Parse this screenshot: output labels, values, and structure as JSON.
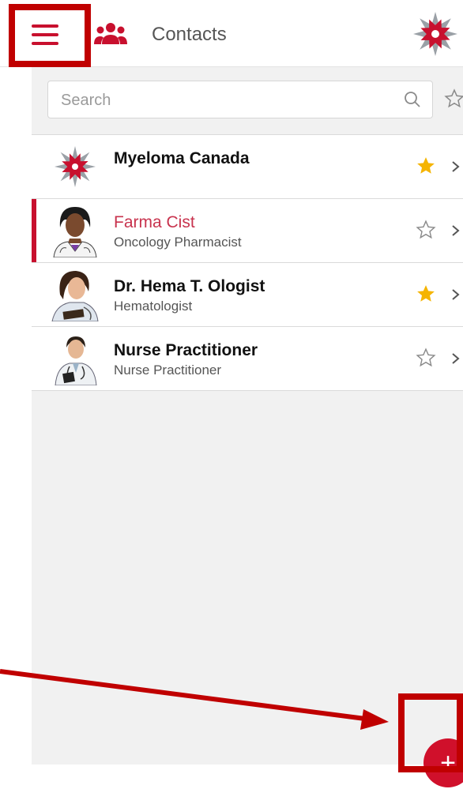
{
  "header": {
    "title": "Contacts",
    "icons": {
      "menu": "hamburger-menu-icon",
      "section": "people-icon",
      "logo": "myeloma-logo-icon"
    },
    "accent_color": "#c8102e"
  },
  "search": {
    "placeholder": "Search",
    "value": ""
  },
  "contacts": [
    {
      "name": "Myeloma Canada",
      "role": "",
      "favorite": true,
      "avatar": "myeloma-logo"
    },
    {
      "name": "Farma Cist",
      "role": "Oncology Pharmacist",
      "favorite": false,
      "avatar": "pharmacist-portrait",
      "selected": true
    },
    {
      "name": "Dr. Hema T. Ologist",
      "role": "Hematologist",
      "favorite": true,
      "avatar": "doctor-portrait"
    },
    {
      "name": "Nurse Practitioner",
      "role": "Nurse Practitioner",
      "favorite": false,
      "avatar": "nurse-portrait"
    }
  ],
  "fab": {
    "label": "+"
  },
  "colors": {
    "star_filled": "#f5b400",
    "star_outline": "#9a9a9a",
    "annotation": "#c00000"
  }
}
